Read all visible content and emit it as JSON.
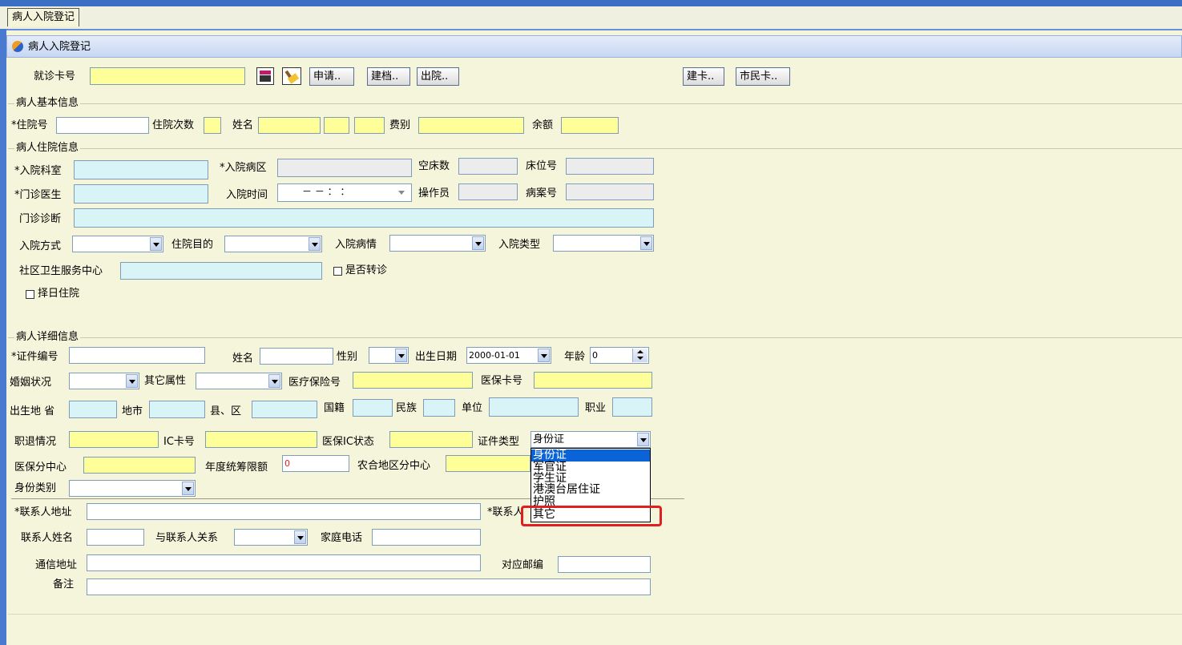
{
  "tab": {
    "label": "病人入院登记"
  },
  "window": {
    "title": "病人入院登记"
  },
  "toolbar": {
    "card_label": "就诊卡号",
    "card_value": "",
    "apply": "申请..",
    "archive": "建档..",
    "discharge": "出院..",
    "build_card": "建卡..",
    "citizen_card": "市民卡.."
  },
  "basic": {
    "title": "病人基本信息",
    "inpatient_no": "*住院号",
    "times": "住院次数",
    "name": "姓名",
    "fee_type": "费别",
    "balance": "余额"
  },
  "stay": {
    "title": "病人住院信息",
    "dept": "*入院科室",
    "ward": "*入院病区",
    "empty_beds": "空床数",
    "bed_no": "床位号",
    "doctor": "*门诊医生",
    "admit_time": "入院时间",
    "admit_time_value": "－  －     ：  ：",
    "operator": "操作员",
    "case_no": "病案号",
    "diagnosis": "门诊诊断",
    "admit_method": "入院方式",
    "purpose": "住院目的",
    "condition": "入院病情",
    "admit_type": "入院类型",
    "community": "社区卫生服务中心",
    "transfer": "是否转诊",
    "select_day": "择日住院"
  },
  "detail": {
    "title": "病人详细信息",
    "id_no": "*证件编号",
    "name": "姓名",
    "gender": "性别",
    "birth_date": "出生日期",
    "birth_date_value": "2000-01-01",
    "age": "年龄",
    "age_value": "0",
    "marital": "婚姻状况",
    "other_attr": "其它属性",
    "insurance_no": "医疗保险号",
    "insurance_card": "医保卡号",
    "birthplace": "出生地 省",
    "city": "地市",
    "county": "县、区",
    "nationality": "国籍",
    "ethnicity": "民族",
    "employer": "单位",
    "occupation": "职业",
    "retire": "职退情况",
    "ic_card": "IC卡号",
    "ic_status": "医保IC状态",
    "doc_type": "证件类型",
    "doc_type_value": "身份证",
    "branch": "医保分中心",
    "annual_limit": "年度统筹限额",
    "annual_limit_value": "0",
    "rural_branch": "农合地区分中心",
    "identity_type": "身份类别",
    "contact_addr": "*联系人地址",
    "contact_phone_partial": "*联系人",
    "contact_name": "联系人姓名",
    "relation": "与联系人关系",
    "home_phone": "家庭电话",
    "mail_addr": "通信地址",
    "postcode": "对应邮编",
    "remark": "备注"
  },
  "doc_type_options": [
    "身份证",
    "军官证",
    "学生证",
    "港澳台居住证",
    "护照",
    "其它"
  ],
  "doc_type_selected_index": 0,
  "colors": {
    "required_yellow": "#ffff99",
    "cyan": "#d8f4f7",
    "highlight": "#e02020",
    "selection": "#0a64d8"
  }
}
